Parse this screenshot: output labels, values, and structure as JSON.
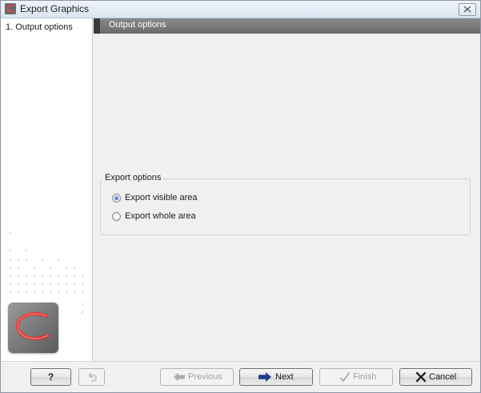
{
  "window": {
    "title": "Export Graphics"
  },
  "steps": {
    "items": [
      {
        "label": "1. Output options",
        "selected": true
      }
    ]
  },
  "content": {
    "section_header": "Output options",
    "export_options": {
      "legend": "Export options",
      "options": [
        {
          "label": "Export visible area",
          "checked": true
        },
        {
          "label": "Export whole area",
          "checked": false
        }
      ]
    }
  },
  "buttons": {
    "help": {
      "label": "?",
      "icon": "question-icon"
    },
    "reset": {
      "label": "",
      "icon": "reset-icon",
      "enabled": false
    },
    "previous": {
      "label": "Previous",
      "icon": "arrow-left-icon",
      "enabled": false
    },
    "next": {
      "label": "Next",
      "icon": "arrow-right-icon",
      "enabled": true
    },
    "finish": {
      "label": "Finish",
      "icon": "checkmark-icon",
      "enabled": false
    },
    "cancel": {
      "label": "Cancel",
      "icon": "x-icon",
      "enabled": true
    }
  },
  "colors": {
    "header_bg": "#7a7a7a",
    "brand_red": "#d42b2b",
    "radio_selected": "#1d5fb7",
    "next_arrow": "#1f3f8a"
  }
}
